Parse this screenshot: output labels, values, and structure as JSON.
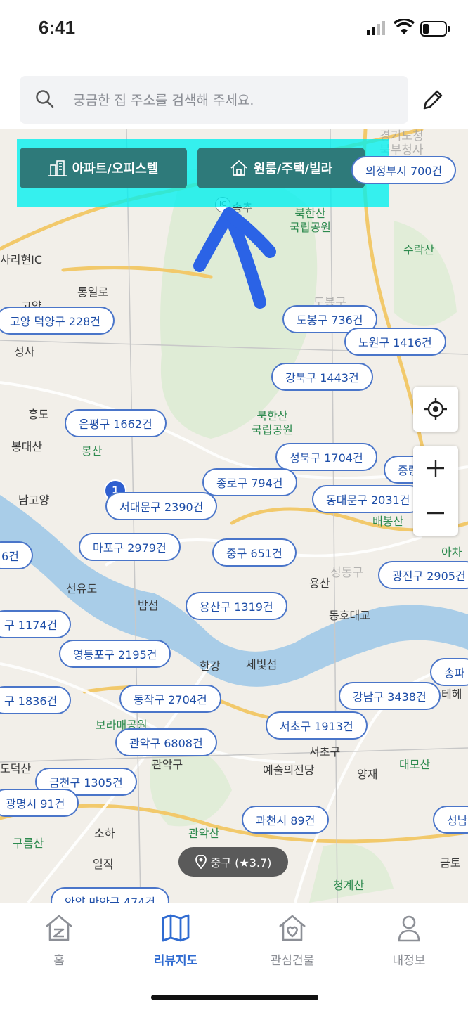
{
  "status": {
    "time": "6:41"
  },
  "search": {
    "placeholder": "궁금한 집 주소를 검색해 주세요."
  },
  "property_tabs": [
    {
      "label": "아파트/오피스텔",
      "icon": "building-icon"
    },
    {
      "label": "원룸/주택/빌라",
      "icon": "house-icon"
    }
  ],
  "annotation": {
    "highlight_color": "#00f0f0",
    "arrow_color": "#2b63e6"
  },
  "district_counts": [
    {
      "label": "의정부시 700건"
    },
    {
      "label": "고양 덕양구 228건"
    },
    {
      "label": "도봉구 736건"
    },
    {
      "label": "노원구 1416건"
    },
    {
      "label": "강북구 1443건"
    },
    {
      "label": "은평구 1662건"
    },
    {
      "label": "성북구 1704건"
    },
    {
      "label": "종로구 794건"
    },
    {
      "label": "동대문구 2031건"
    },
    {
      "label": "서대문구 2390건"
    },
    {
      "label": "마포구 2979건"
    },
    {
      "label": "중구 651건"
    },
    {
      "label": "광진구 2905건"
    },
    {
      "label": "용산구 1319건"
    },
    {
      "label": "구 1174건"
    },
    {
      "label": "영등포구 2195건"
    },
    {
      "label": "동작구 2704건"
    },
    {
      "label": "강남구 3438건"
    },
    {
      "label": "구 1836건"
    },
    {
      "label": "서초구 1913건"
    },
    {
      "label": "관악구 6808건"
    },
    {
      "label": "금천구 1305건"
    },
    {
      "label": "광명시 91건"
    },
    {
      "label": "과천시 89건"
    },
    {
      "label": "안양 만안구 474건"
    },
    {
      "label": "6건"
    },
    {
      "label": "중랑"
    },
    {
      "label": "송파"
    },
    {
      "label": "성남"
    }
  ],
  "map_places": [
    {
      "label": "송추"
    },
    {
      "label": "북한산\n국립공원"
    },
    {
      "label": "수락산"
    },
    {
      "label": "사리현IC"
    },
    {
      "label": "통일로"
    },
    {
      "label": "고양"
    },
    {
      "label": "성사"
    },
    {
      "label": "흥도"
    },
    {
      "label": "봉대산"
    },
    {
      "label": "봉산"
    },
    {
      "label": "남고양"
    },
    {
      "label": "선유도"
    },
    {
      "label": "밤섬"
    },
    {
      "label": "한강"
    },
    {
      "label": "세빛섬"
    },
    {
      "label": "보라매공원"
    },
    {
      "label": "관악구"
    },
    {
      "label": "예술의전당"
    },
    {
      "label": "서초구"
    },
    {
      "label": "양재"
    },
    {
      "label": "대모산"
    },
    {
      "label": "소하"
    },
    {
      "label": "구름산"
    },
    {
      "label": "일직"
    },
    {
      "label": "관악산"
    },
    {
      "label": "청계산"
    },
    {
      "label": "금토"
    },
    {
      "label": "배봉산"
    },
    {
      "label": "동호대교"
    },
    {
      "label": "용산"
    },
    {
      "label": "성동구"
    },
    {
      "label": "도덕산"
    },
    {
      "label": "아차"
    },
    {
      "label": "테헤"
    },
    {
      "label": "북한산\n국립공원"
    },
    {
      "label": "경기도청\n북부청사"
    },
    {
      "label": "도봉구"
    },
    {
      "label": "IC"
    }
  ],
  "location_pill": {
    "text": "중구 (★3.7)"
  },
  "cluster_marker": {
    "count": "1"
  },
  "nav": [
    {
      "label": "홈",
      "icon": "home-icon"
    },
    {
      "label": "리뷰지도",
      "icon": "map-icon",
      "active": true
    },
    {
      "label": "관심건물",
      "icon": "heart-house-icon"
    },
    {
      "label": "내정보",
      "icon": "person-icon"
    }
  ],
  "colors": {
    "accent": "#2f6bd1",
    "tab_button": "#2e7a7a",
    "badge_text": "#1e4ea8"
  }
}
